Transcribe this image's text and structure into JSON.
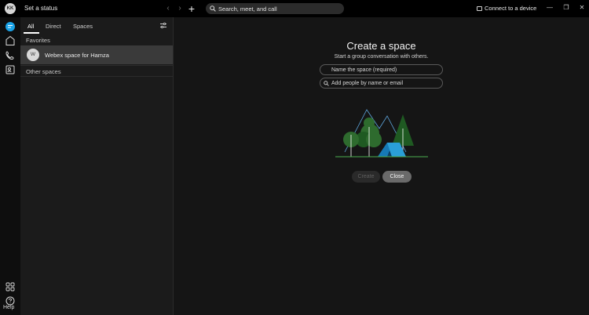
{
  "topbar": {
    "avatar_initials": "KK",
    "status_text": "Set a status",
    "search_placeholder": "Search, meet, and call",
    "connect_label": "Connect to a device",
    "plus_label": "+"
  },
  "rail": {
    "help_label": "Help",
    "accent_color": "#1aa3e8"
  },
  "panel": {
    "tabs": [
      {
        "label": "All",
        "active": true
      },
      {
        "label": "Direct",
        "active": false
      },
      {
        "label": "Spaces",
        "active": false
      }
    ],
    "favorites_label": "Favorites",
    "favorites": [
      {
        "avatar": "W",
        "label": "Webex space for Hamza"
      }
    ],
    "other_spaces_label": "Other spaces"
  },
  "create_space": {
    "title": "Create a space",
    "subtitle": "Start a group conversation with others.",
    "name_placeholder": "Name the space (required)",
    "people_placeholder": "Add people by name or email",
    "create_label": "Create",
    "close_label": "Close"
  },
  "colors": {
    "tree_green": "#2e6b2e",
    "tree_outline": "#5fa8e0",
    "tent_blue": "#2a9fd8",
    "ground_green": "#4caf50"
  }
}
